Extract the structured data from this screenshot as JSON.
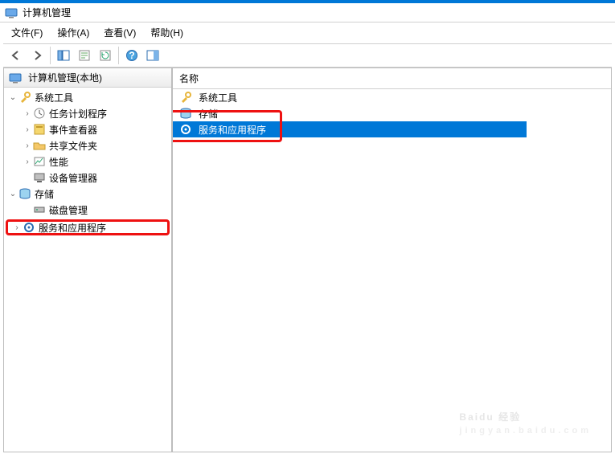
{
  "title": "计算机管理",
  "menu": {
    "file": "文件(F)",
    "action": "操作(A)",
    "view": "查看(V)",
    "help": "帮助(H)"
  },
  "toolbar_icons": {
    "back": "back-arrow",
    "forward": "forward-arrow",
    "up": "up",
    "props": "properties",
    "refresh": "refresh",
    "help": "help",
    "details": "details"
  },
  "tree_root": "计算机管理(本地)",
  "tree": {
    "system_tools": "系统工具",
    "task_scheduler": "任务计划程序",
    "event_viewer": "事件查看器",
    "shared_folders": "共享文件夹",
    "performance": "性能",
    "device_manager": "设备管理器",
    "storage": "存储",
    "disk_mgmt": "磁盘管理",
    "services_apps": "服务和应用程序"
  },
  "detail": {
    "col_name": "名称",
    "row_system_tools": "系统工具",
    "row_storage": "存储",
    "row_services_apps": "服务和应用程序"
  },
  "watermark": {
    "brand": "Baidu 经验",
    "sub": "jingyan.baidu.com"
  }
}
